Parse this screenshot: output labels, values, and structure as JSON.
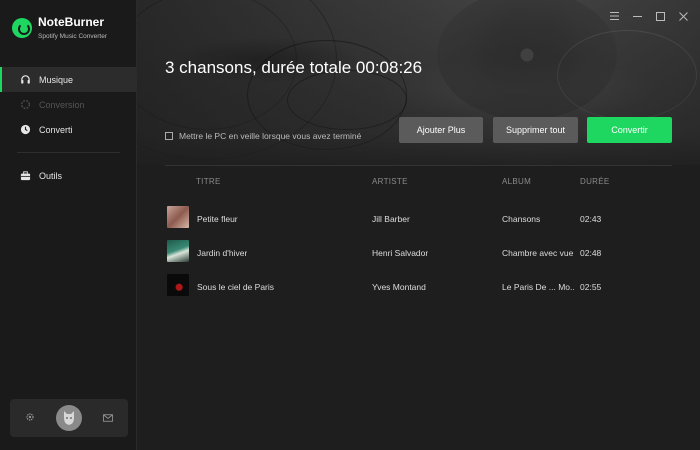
{
  "brand": {
    "name": "NoteBurner",
    "subtitle": "Spotify Music Converter"
  },
  "sidebar": {
    "items": [
      {
        "label": "Musique",
        "icon": "headphones-icon",
        "state": "active"
      },
      {
        "label": "Conversion",
        "icon": "spinner-icon",
        "state": "disabled"
      },
      {
        "label": "Converti",
        "icon": "clock-icon",
        "state": "normal"
      },
      {
        "label": "Outils",
        "icon": "toolbox-icon",
        "state": "normal"
      }
    ],
    "bottom_icons": [
      "settings-icon",
      "avatar",
      "mail-icon"
    ]
  },
  "header": {
    "title": "3 chansons, durée totale 00:08:26",
    "sleep_label": "Mettre le PC en veille lorsque vous avez terminé",
    "sleep_checked": false,
    "buttons": {
      "add": "Ajouter Plus",
      "delete": "Supprimer tout",
      "convert": "Convertir"
    }
  },
  "table": {
    "columns": {
      "title": "TITRE",
      "artist": "ARTISTE",
      "album": "ALBUM",
      "duration": "DURÉE"
    },
    "rows": [
      {
        "title": "Petite fleur",
        "artist": "Jill Barber",
        "album": "Chansons",
        "duration": "02:43"
      },
      {
        "title": "Jardin d'hiver",
        "artist": "Henri Salvador",
        "album": "Chambre avec vue",
        "duration": "02:48"
      },
      {
        "title": "Sous le ciel de Paris",
        "artist": "Yves Montand",
        "album": "Le Paris De ... Mo...",
        "duration": "02:55"
      }
    ]
  },
  "colors": {
    "accent": "#1ed760",
    "sidebar_bg": "#1a1a1a",
    "main_bg": "#1e1e1e",
    "button_gray": "#5b5b5b"
  }
}
